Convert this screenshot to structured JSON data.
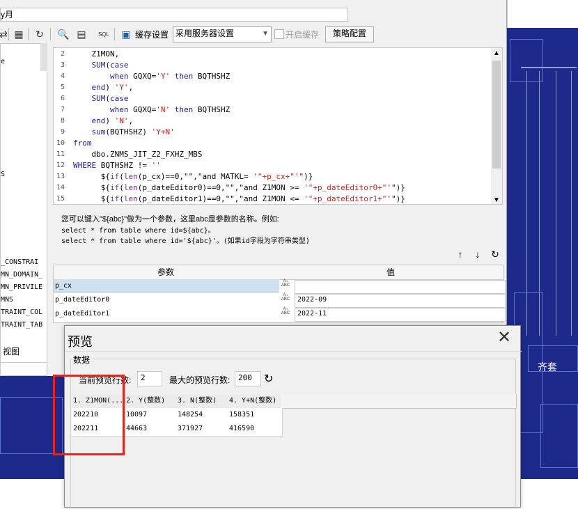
{
  "title_input": {
    "value": "y月"
  },
  "toolbar": {
    "cache_label": "缓存设置",
    "cache_select": "采用服务器设置",
    "enable_cache": "开启缓存",
    "strategy_button": "策略配置",
    "icons": [
      "swap-icon",
      "table-icon",
      "refresh-icon",
      "preview-icon",
      "save-icon",
      "sql-icon",
      "db-icon"
    ]
  },
  "left_tree": {
    "items": [
      "e",
      "S",
      "_CONSTRAI",
      "MN_DOMAIN_",
      "MN_PRIVILE",
      "MNS",
      "TRAINT_COL",
      "TRAINT_TAB"
    ],
    "view_label": "视图"
  },
  "editor": {
    "lines": [
      {
        "n": "2",
        "text": "    Z1MON,"
      },
      {
        "n": "3",
        "text": "    SUM(case"
      },
      {
        "n": "4",
        "text": "        when GQXQ='Y' then BQTHSHZ"
      },
      {
        "n": "5",
        "text": "    end) 'Y',"
      },
      {
        "n": "6",
        "text": "    SUM(case"
      },
      {
        "n": "7",
        "text": "        when GQXQ='N' then BQTHSHZ"
      },
      {
        "n": "8",
        "text": "    end) 'N',"
      },
      {
        "n": "9",
        "text": "    sum(BQTHSHZ) 'Y+N'"
      },
      {
        "n": "10",
        "text": "from"
      },
      {
        "n": "11",
        "text": "    dbo.ZNMS_JIT_Z2_FXHZ_MBS"
      },
      {
        "n": "12",
        "text": "WHERE BQTHSHZ != ''"
      },
      {
        "n": "13",
        "text": "      ${if(len(p_cx)==0,\"\",\"and MATKL= '\"+p_cx+\"'\")}"
      },
      {
        "n": "14",
        "text": "      ${if(len(p_dateEditor0)==0,\"\",\"and Z1MON >= '\"+p_dateEditor0+\"'\")}"
      },
      {
        "n": "15",
        "text": "      ${if(len(p_dateEditor1)==0,\"\",\"and Z1MON <= '\"+p_dateEditor1+\"'\")}"
      }
    ]
  },
  "hint": {
    "line1": "您可以键入\"${abc}\"做为一个参数，这里abc是参数的名称。例如:",
    "line2": "select * from table where id=${abc}。",
    "line3": "select * from table where id='${abc}'。(如果id字段为字符串类型)"
  },
  "params": {
    "headers": [
      "参数",
      "值"
    ],
    "rows": [
      {
        "name": "p_cx",
        "value": ""
      },
      {
        "name": "p_dateEditor0",
        "value": "2022-09"
      },
      {
        "name": "p_dateEditor1",
        "value": "2022-11"
      }
    ],
    "type_badge": "ABC"
  },
  "preview": {
    "title": "预览",
    "group_label": "数据",
    "current_rows_label": "当前预览行数:",
    "current_rows": "2",
    "max_rows_label": "最大的预览行数:",
    "max_rows": "200",
    "columns": [
      "1. Z1MON(...",
      "2. Y(整数)",
      "3. N(整数)",
      "4. Y+N(整数)"
    ],
    "rows": [
      [
        "202210",
        "10097",
        "148254",
        "158351"
      ],
      [
        "202211",
        "44663",
        "371927",
        "416590"
      ]
    ]
  },
  "background": {
    "right_text": "齐套"
  },
  "colors": {
    "dashboard_bg": "#1d2a8c",
    "highlight_red": "#e8231a",
    "selected_row": "#cfe0ef"
  }
}
